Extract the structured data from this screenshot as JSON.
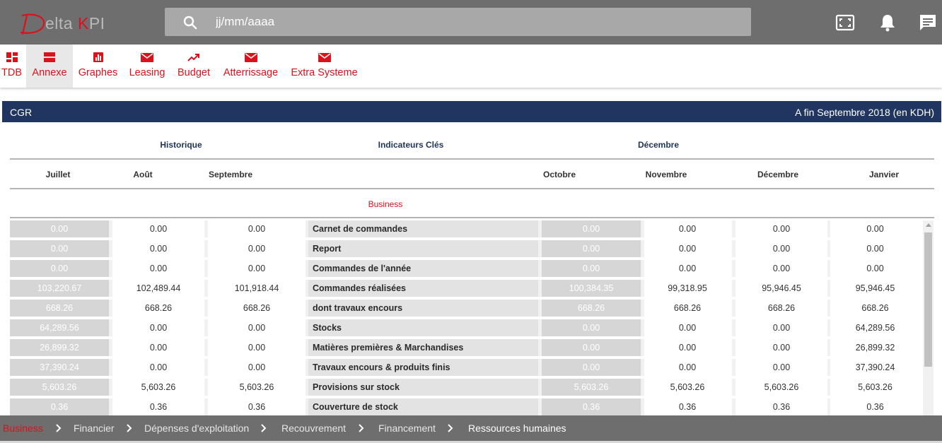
{
  "app": {
    "logo_first_letter": "D",
    "logo_text_before": "elta ",
    "logo_text_k": "K",
    "logo_text_after": "PI",
    "brand_color": "#d9121b"
  },
  "search": {
    "placeholder": "jj/mm/aaaa"
  },
  "top_icons": [
    "fullscreen-icon",
    "bell-icon",
    "chat-icon"
  ],
  "nav": {
    "tabs": [
      {
        "label": "TDB",
        "icon": "dashboard-icon"
      },
      {
        "label": "Annexe",
        "icon": "annexe-icon",
        "active": true
      },
      {
        "label": "Graphes",
        "icon": "bar-chart-icon"
      },
      {
        "label": "Leasing",
        "icon": "mail-icon"
      },
      {
        "label": "Budget",
        "icon": "trending-up-icon"
      },
      {
        "label": "Atterrissage",
        "icon": "mail-icon"
      },
      {
        "label": "Extra Systeme",
        "icon": "mail-icon"
      }
    ]
  },
  "panel": {
    "title": "CGR",
    "period": "A fin Septembre 2018 (en KDH)"
  },
  "headers": {
    "historique": "Historique",
    "indicateurs": "Indicateurs Clés",
    "decembre": "Décembre",
    "months": [
      "Juillet",
      "Août",
      "Septembre",
      "Octobre",
      "Novembre",
      "Décembre",
      "Janvier"
    ]
  },
  "section_label": "Business",
  "rows": [
    {
      "label": "Carnet de commandes",
      "values": [
        "0.00",
        "0.00",
        "0.00",
        "0.00",
        "0.00",
        "0.00",
        "0.00"
      ]
    },
    {
      "label": "Report",
      "values": [
        "0.00",
        "0.00",
        "0.00",
        "0.00",
        "0.00",
        "0.00",
        "0.00"
      ]
    },
    {
      "label": "Commandes de l'année",
      "values": [
        "0.00",
        "0.00",
        "0.00",
        "0.00",
        "0.00",
        "0.00",
        "0.00"
      ]
    },
    {
      "label": "Commandes réalisées",
      "values": [
        "103,220.67",
        "102,489.44",
        "101,918.44",
        "100,384.35",
        "99,318.95",
        "95,946.45",
        "95,946.45"
      ]
    },
    {
      "label": "dont travaux encours",
      "values": [
        "668.26",
        "668.26",
        "668.26",
        "668.26",
        "668.26",
        "668.26",
        "668.26"
      ]
    },
    {
      "label": "Stocks",
      "values": [
        "64,289.56",
        "0.00",
        "0.00",
        "0.00",
        "0.00",
        "0.00",
        "64,289.56"
      ]
    },
    {
      "label": "Matières premières & Marchandises",
      "values": [
        "26,899.32",
        "0.00",
        "0.00",
        "0.00",
        "0.00",
        "0.00",
        "26,899.32"
      ]
    },
    {
      "label": "Travaux encours & produits finis",
      "values": [
        "37,390.24",
        "0.00",
        "0.00",
        "0.00",
        "0.00",
        "0.00",
        "37,390.24"
      ]
    },
    {
      "label": "Provisions sur stock",
      "values": [
        "5,603.26",
        "5,603.26",
        "5,603.26",
        "5,603.26",
        "5,603.26",
        "5,603.26",
        "5,603.26"
      ]
    },
    {
      "label": "Couverture de stock",
      "values": [
        "0.36",
        "0.36",
        "0.36",
        "0.36",
        "0.36",
        "0.36",
        "0.36"
      ]
    }
  ],
  "breadcrumbs": [
    {
      "label": "Business",
      "state": "active"
    },
    {
      "label": "Financier"
    },
    {
      "label": "Dépenses d'exploitation"
    },
    {
      "label": "Recouvrement"
    },
    {
      "label": "Financement"
    },
    {
      "label": "Ressources humaines",
      "state": "last"
    }
  ]
}
